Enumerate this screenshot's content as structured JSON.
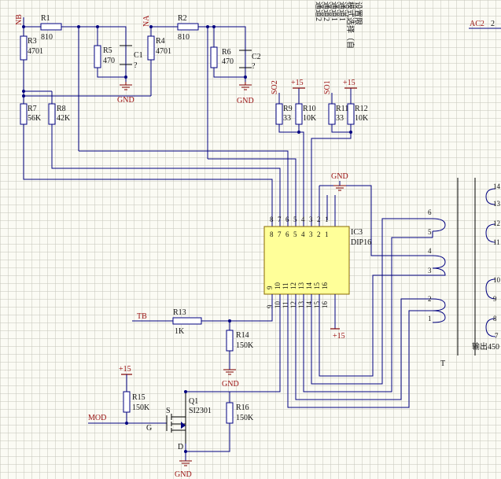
{
  "nets": {
    "nb": "NB",
    "na": "NA",
    "so2": "SO2",
    "so1": "SO1",
    "tb": "TB",
    "mod": "MOD",
    "p15a": "+15",
    "p15b": "+15",
    "p15c": "+15",
    "p15d": "+15",
    "gnd1": "GND",
    "gnd2": "GND",
    "gnd3": "GND",
    "gnd4": "GND",
    "gnd5": "GND",
    "gnd6": "GND",
    "ac2": "AC2",
    "ac2_pin": "2"
  },
  "components": {
    "r1": {
      "ref": "R1",
      "val": "810"
    },
    "r2": {
      "ref": "R2",
      "val": "810"
    },
    "r3": {
      "ref": "R3",
      "val": "4701"
    },
    "r4": {
      "ref": "R4",
      "val": "4701"
    },
    "r5": {
      "ref": "R5",
      "val": "470"
    },
    "r6": {
      "ref": "R6",
      "val": "470"
    },
    "c1": {
      "ref": "C1",
      "val": "?"
    },
    "c2": {
      "ref": "C2",
      "val": "?"
    },
    "r7": {
      "ref": "R7",
      "val": "56K"
    },
    "r8": {
      "ref": "R8",
      "val": "42K"
    },
    "r9": {
      "ref": "R9",
      "val": "33"
    },
    "r10": {
      "ref": "R10",
      "val": "10K"
    },
    "r11": {
      "ref": "R11",
      "val": "33"
    },
    "r12": {
      "ref": "R12",
      "val": "10K"
    },
    "r13": {
      "ref": "R13",
      "val": "1K"
    },
    "r14": {
      "ref": "R14",
      "val": "150K"
    },
    "r15": {
      "ref": "R15",
      "val": "150K"
    },
    "r16": {
      "ref": "R16",
      "val": "150K"
    },
    "q1": {
      "ref": "Q1",
      "val": "SI2301",
      "g": "G",
      "s": "S",
      "d": "D"
    },
    "ic3": {
      "ref": "IC3",
      "val": "DIP16"
    },
    "t": {
      "ref": "T"
    }
  },
  "ic_pins": {
    "top": [
      "8",
      "7",
      "6",
      "5",
      "4",
      "3",
      "2",
      "1"
    ],
    "bottom": [
      "9",
      "10",
      "11",
      "12",
      "13",
      "14",
      "15",
      "16"
    ]
  },
  "transformer": {
    "primary": [
      "6",
      "5",
      "4",
      "3",
      "2",
      "1"
    ],
    "secondary": [
      "14",
      "13",
      "12",
      "11",
      "10",
      "9",
      "8",
      "7"
    ],
    "partial_label": "输出450"
  },
  "notes": [
    "通道2",
    "通道2",
    "通道1",
    "通道1",
    "模式选择（自",
    "设置限"
  ]
}
